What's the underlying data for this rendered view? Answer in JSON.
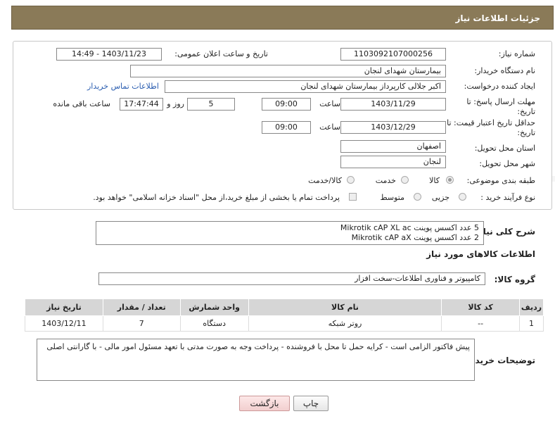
{
  "header": {
    "title": "جزئیات اطلاعات نیاز"
  },
  "form": {
    "need_number_label": "شماره نیاز:",
    "need_number": "1103092107000256",
    "announce_label": "تاریخ و ساعت اعلان عمومی:",
    "announce_value": "1403/11/23 - 14:49",
    "buyer_org_label": "نام دستگاه خریدار:",
    "buyer_org": "بیمارستان شهدای لنجان",
    "creator_label": "ایجاد کننده درخواست:",
    "creator": "اکبر جلالی کارپرداز بیمارستان شهدای لنجان",
    "contact_link": "اطلاعات تماس خریدار",
    "deadline_label_1": "مهلت ارسال پاسخ: تا",
    "deadline_label_2": "تاریخ:",
    "deadline_date": "1403/11/29",
    "time_label": "ساعت",
    "deadline_time": "09:00",
    "days_value": "5",
    "days_label": "روز و",
    "remaining_time": "17:47:44",
    "remaining_label": "ساعت باقی مانده",
    "validity_label_1": "حداقل تاریخ اعتبار قیمت: تا",
    "validity_label_2": "تاریخ:",
    "validity_date": "1403/12/29",
    "validity_time": "09:00",
    "province_label": "استان محل تحویل:",
    "province": "اصفهان",
    "city_label": "شهر محل تحویل:",
    "city": "لنجان",
    "category_label": "طبقه بندی موضوعی:",
    "category_options": [
      "کالا",
      "خدمت",
      "کالا/خدمت"
    ],
    "process_label": "نوع فرآیند خرید :",
    "process_options": [
      "جزیی",
      "متوسط"
    ],
    "payment_note": "پرداخت تمام یا بخشی از مبلغ خرید،از محل \"اسناد خزانه اسلامی\" خواهد بود."
  },
  "summary": {
    "label": "شرح کلی نیاز:",
    "lines": [
      "5 عدد اکسس پوینت Mikrotik cAP XL ac",
      "2 عدد اکسس پوینت Mikrotik cAP aX"
    ]
  },
  "goods": {
    "section_title": "اطلاعات کالاهای مورد نیاز",
    "group_label": "گروه کالا:",
    "group_value": "کامپیوتر و فناوری اطلاعات-سخت افزار",
    "columns": [
      "ردیف",
      "کد کالا",
      "نام کالا",
      "واحد شمارش",
      "تعداد / مقدار",
      "تاریخ نیاز"
    ],
    "rows": [
      [
        "1",
        "--",
        "روتر شبکه",
        "دستگاه",
        "7",
        "1403/12/11"
      ]
    ]
  },
  "buyer_notes": {
    "label": "توضیحات خریدار:",
    "text": "پیش فاکتور الزامی است - کرایه حمل تا محل با فروشنده - پرداخت وجه به صورت مدتی با تعهد مسئول امور مالی - با گارانتی اصلی"
  },
  "buttons": {
    "print": "چاپ",
    "back": "بازگشت"
  },
  "watermark": "AriaTender.neT"
}
